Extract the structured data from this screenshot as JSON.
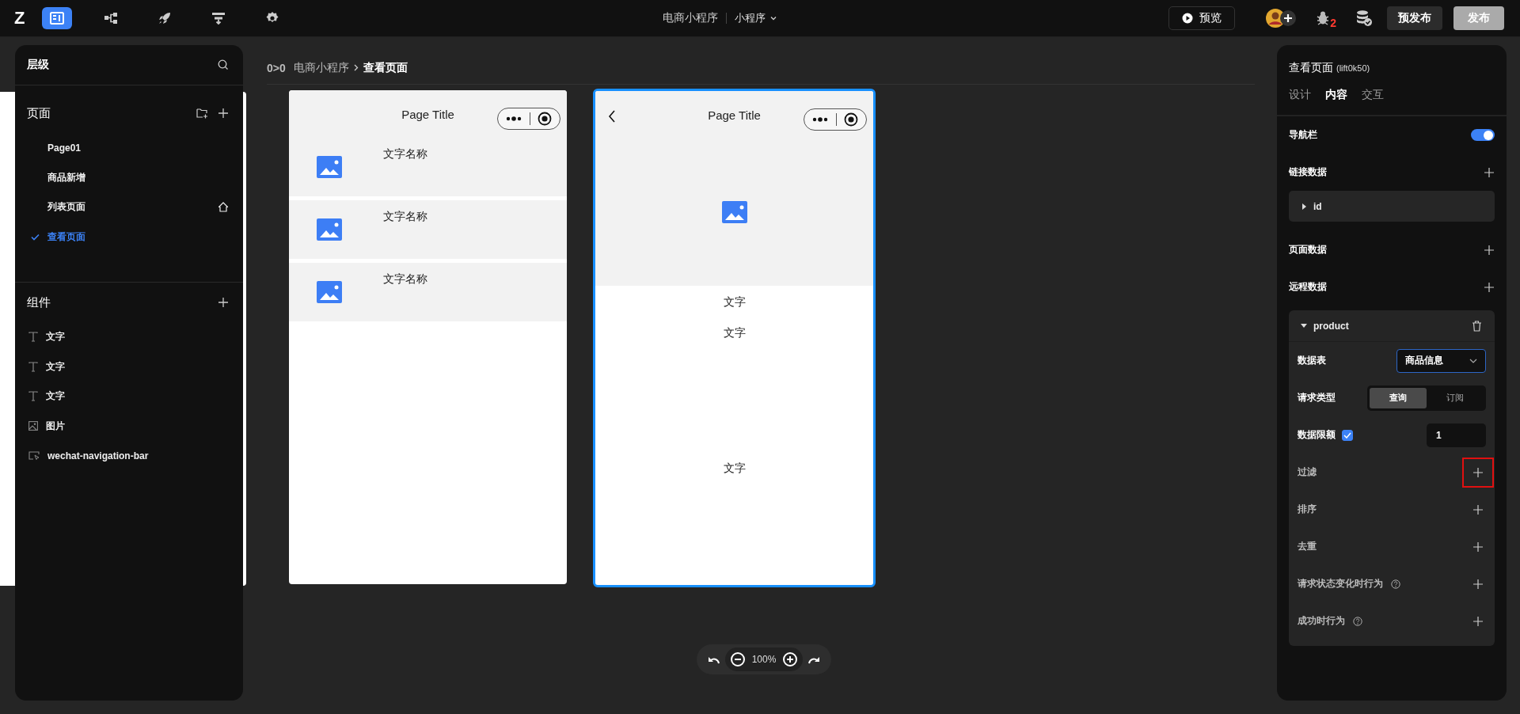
{
  "top_bar": {
    "logo": "Z",
    "tools": [
      {
        "kind": "layout",
        "selected": true
      },
      {
        "kind": "tree",
        "selected": false
      },
      {
        "kind": "rocket",
        "selected": false
      },
      {
        "kind": "flow",
        "selected": false
      },
      {
        "kind": "settings",
        "selected": false
      }
    ],
    "app_name": "电商小程序",
    "app_type": "小程序",
    "preview": "预览",
    "bug_count": "2",
    "buttons": [
      {
        "label": "预发布",
        "kind": "dark"
      },
      {
        "label": "发布",
        "kind": "light"
      }
    ]
  },
  "left_panel": {
    "title": "层级",
    "pages": {
      "title": "页面",
      "items": [
        {
          "label": "Page01",
          "selected": false,
          "home": false
        },
        {
          "label": "商品新增",
          "selected": false,
          "home": false
        },
        {
          "label": "列表页面",
          "selected": false,
          "home": true
        },
        {
          "label": "查看页面",
          "selected": true,
          "home": false
        }
      ]
    },
    "components": {
      "title": "组件",
      "items": [
        {
          "kind": "text",
          "label": "文字"
        },
        {
          "kind": "text",
          "label": "文字"
        },
        {
          "kind": "text",
          "label": "文字"
        },
        {
          "kind": "image",
          "label": "图片"
        },
        {
          "kind": "navbar",
          "label": "wechat-navigation-bar"
        }
      ]
    }
  },
  "breadcrumb": {
    "prefix": "0>0",
    "items": [
      "电商小程序",
      "查看页面"
    ]
  },
  "phones": [
    {
      "kind": "list",
      "title": "Page Title",
      "back": false,
      "selected": false,
      "items": [
        "文字名称",
        "文字名称",
        "文字名称"
      ]
    },
    {
      "kind": "detail",
      "title": "Page Title",
      "back": true,
      "selected": true,
      "items": [
        "文字",
        "文字",
        "文字"
      ]
    }
  ],
  "zoom": "100%",
  "right_panel": {
    "title": "查看页面",
    "id": "(lift0k50)",
    "tabs": [
      {
        "label": "设计",
        "selected": false
      },
      {
        "label": "内容",
        "selected": true
      },
      {
        "label": "交互",
        "selected": false
      }
    ],
    "nav_bar": {
      "label": "导航栏",
      "on": true
    },
    "link_data": {
      "label": "链接数据",
      "items": [
        "id"
      ]
    },
    "page_data": {
      "label": "页面数据"
    },
    "remote_data": {
      "label": "远程数据",
      "source": {
        "name": "product",
        "expanded": true,
        "table_label": "数据表",
        "table_value": "商品信息",
        "request_label": "请求类型",
        "request_options": [
          {
            "label": "查询",
            "selected": true
          },
          {
            "label": "订阅",
            "selected": false
          }
        ],
        "limit_label": "数据限额",
        "limit_checked": true,
        "limit_value": "1",
        "rows": [
          {
            "label": "过滤",
            "help": false,
            "highlighted": true
          },
          {
            "label": "排序",
            "help": false,
            "highlighted": false
          },
          {
            "label": "去重",
            "help": false,
            "highlighted": false
          },
          {
            "label": "请求状态变化时行为",
            "help": true,
            "highlighted": false
          },
          {
            "label": "成功时行为",
            "help": true,
            "highlighted": false
          }
        ]
      }
    }
  }
}
